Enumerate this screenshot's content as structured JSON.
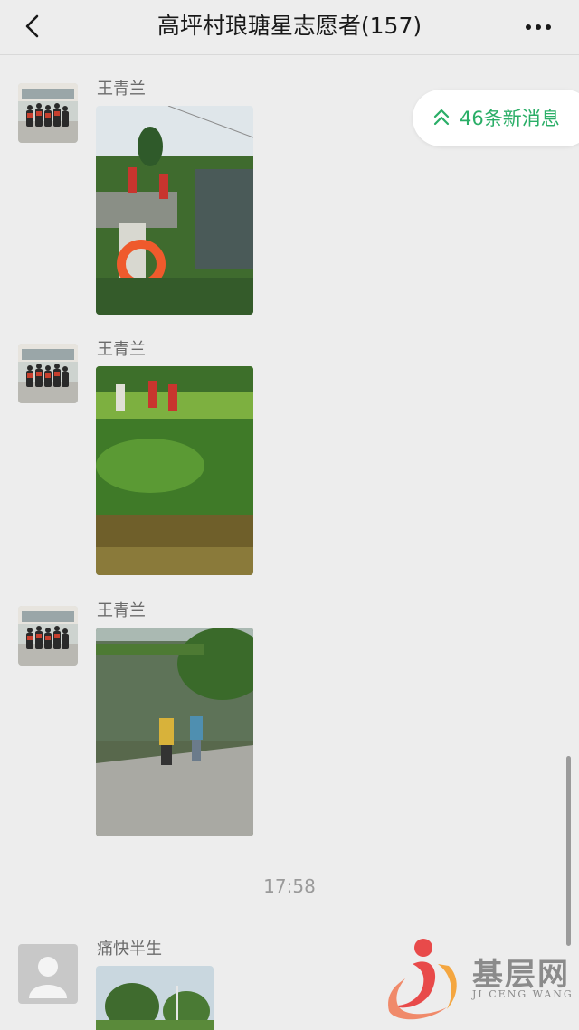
{
  "header": {
    "title": "高坪村琅瑭星志愿者(157)",
    "back_icon": "chevron-left-icon",
    "more_icon": "more-dots-icon"
  },
  "new_messages": {
    "label": "46条新消息",
    "icon": "double-chevron-up-icon",
    "color": "#2aae67"
  },
  "messages": [
    {
      "sender": "王青兰",
      "type": "image"
    },
    {
      "sender": "王青兰",
      "type": "image"
    },
    {
      "sender": "王青兰",
      "type": "image"
    },
    {
      "sender": "痛快半生",
      "type": "image"
    }
  ],
  "timestamp": "17:58",
  "watermark": {
    "title": "基层网",
    "subtitle": "JI CENG WANG"
  }
}
